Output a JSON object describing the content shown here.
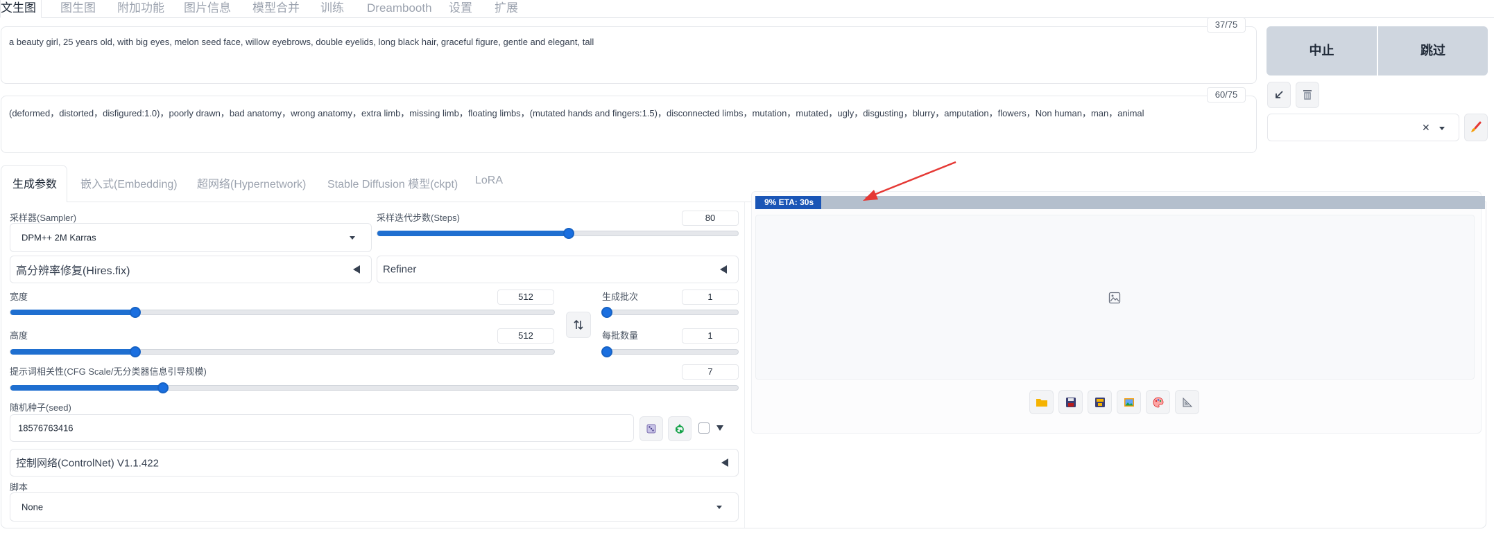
{
  "top_tabs": [
    "文生图",
    "图生图",
    "附加功能",
    "图片信息",
    "模型合并",
    "训练",
    "Dreambooth",
    "设置",
    "扩展"
  ],
  "prompt": {
    "positive_text": "a beauty girl, 25 years old, with big eyes, melon seed face, willow eyebrows, double eyelids, long black hair, graceful figure, gentle and elegant, tall",
    "positive_tokens": "37/75",
    "negative_text": "(deformed，distorted，disfigured:1.0)，poorly drawn，bad anatomy，wrong anatomy，extra limb，missing limb，floating limbs，(mutated hands and fingers:1.5)，disconnected limbs，mutation，mutated，ugly，disgusting，blurry，amputation，flowers，Non human，man，animal",
    "negative_tokens": "60/75"
  },
  "actions": {
    "interrupt_label": "中止",
    "skip_label": "跳过",
    "style_value": ""
  },
  "gen_tabs": [
    "生成参数",
    "嵌入式(Embedding)",
    "超网络(Hypernetwork)",
    "Stable Diffusion 模型(ckpt)",
    "LoRA"
  ],
  "params": {
    "sampler_label": "采样器(Sampler)",
    "sampler_value": "DPM++ 2M Karras",
    "steps_label": "采样迭代步数(Steps)",
    "steps_value": "80",
    "steps_fraction": 0.53,
    "hires_label": "高分辨率修复(Hires.fix)",
    "refiner_label": "Refiner",
    "width_label": "宽度",
    "width_value": "512",
    "width_fraction": 0.23,
    "height_label": "高度",
    "height_value": "512",
    "height_fraction": 0.23,
    "batch_count_label": "生成批次",
    "batch_count_value": "1",
    "batch_count_fraction": 0.0,
    "batch_size_label": "每批数量",
    "batch_size_value": "1",
    "batch_size_fraction": 0.0,
    "cfg_label": "提示词相关性(CFG Scale/无分类器信息引导规模)",
    "cfg_value": "7",
    "cfg_fraction": 0.21,
    "seed_label": "随机种子(seed)",
    "seed_value": "18576763416",
    "controlnet_label": "控制网络(ControlNet) V1.1.422",
    "script_label": "脚本",
    "script_value": "None"
  },
  "output": {
    "progress_label": "9% ETA: 30s",
    "progress_fraction": 0.09
  },
  "colors": {
    "accent": "#1a6fe0",
    "progress_fill": "#1a55b6",
    "progress_track": "#b4bfcd",
    "action_button": "#cfd6df",
    "arrow": "#e53935"
  }
}
